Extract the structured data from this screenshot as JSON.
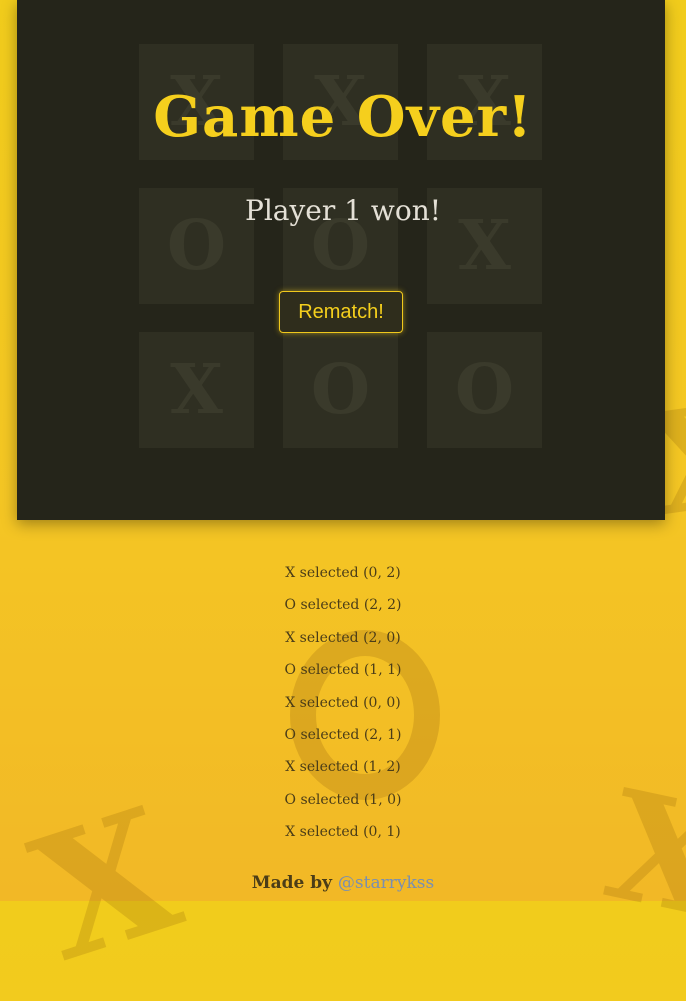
{
  "board": [
    [
      "X",
      "X",
      "X"
    ],
    [
      "O",
      "O",
      "X"
    ],
    [
      "X",
      "O",
      "O"
    ]
  ],
  "overlay": {
    "title": "Game Over!",
    "result": "Player 1 won!",
    "rematch_label": "Rematch!"
  },
  "move_log": [
    "X selected (0, 2)",
    "O selected (2, 2)",
    "X selected (2, 0)",
    "O selected (1, 1)",
    "X selected (0, 0)",
    "O selected (2, 1)",
    "X selected (1, 2)",
    "O selected (1, 0)",
    "X selected (0, 1)"
  ],
  "footer": {
    "prefix": "Made by",
    "author": "@starrykss"
  },
  "colors": {
    "accent": "#f5cf1d",
    "panel": "#25251a",
    "cell": "#2f2f22",
    "link": "#7a8fb0"
  }
}
